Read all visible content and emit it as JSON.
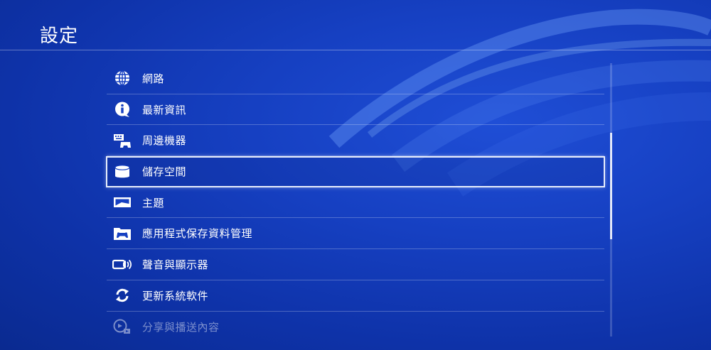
{
  "header": {
    "title": "設定"
  },
  "menu": {
    "items": [
      {
        "label": "網路",
        "icon": "globe-icon"
      },
      {
        "label": "最新資訊",
        "icon": "info-icon"
      },
      {
        "label": "周邊機器",
        "icon": "peripherals-icon"
      },
      {
        "label": "儲存空間",
        "icon": "storage-icon",
        "selected": true
      },
      {
        "label": "主題",
        "icon": "theme-icon"
      },
      {
        "label": "應用程式保存資料管理",
        "icon": "saved-data-icon"
      },
      {
        "label": "聲音與顯示器",
        "icon": "sound-display-icon"
      },
      {
        "label": "更新系統軟件",
        "icon": "update-icon"
      },
      {
        "label": "分享與播送內容",
        "icon": "share-broadcast-icon"
      }
    ]
  },
  "colors": {
    "background": "#1640c2",
    "selection_border": "#e8eefc",
    "text": "#ffffff"
  }
}
